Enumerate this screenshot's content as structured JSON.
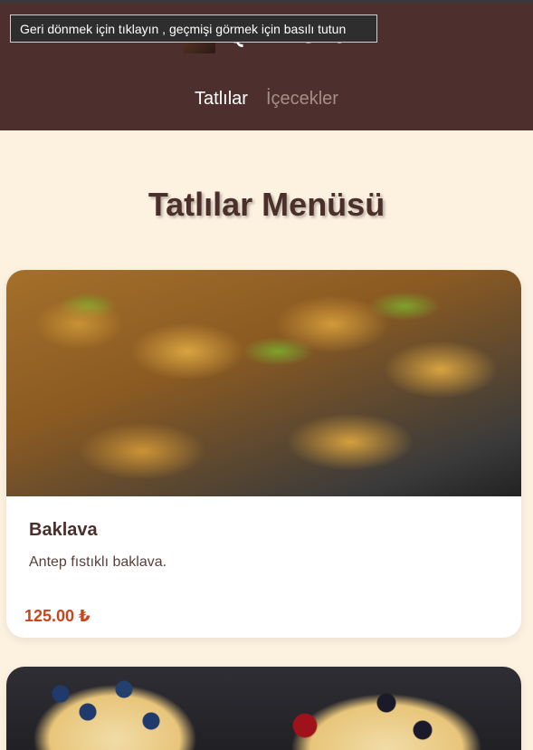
{
  "browser": {
    "back_tooltip": "Geri dönmek için tıklayın , geçmişi görmek için basılı tutun"
  },
  "header": {
    "brand": "QR Menu",
    "nav": [
      {
        "label": "Tatlılar",
        "active": true
      },
      {
        "label": "İçecekler",
        "active": false
      }
    ]
  },
  "main": {
    "title": "Tatlılar Menüsü",
    "items": [
      {
        "name": "Baklava",
        "description": "Antep fıstıklı baklava.",
        "price": "125.00 ₺"
      }
    ]
  },
  "colors": {
    "header_bg": "#4d302d",
    "page_bg": "#fdf1e0",
    "price": "#c7461e"
  }
}
